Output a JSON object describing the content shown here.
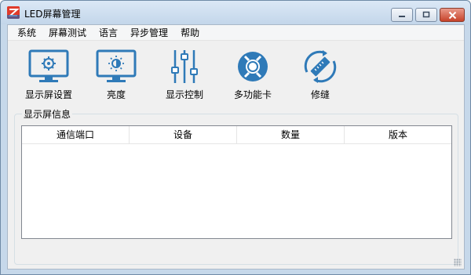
{
  "window": {
    "title": "LED屏幕管理"
  },
  "menu": [
    {
      "label": "系统",
      "name": "menu-system"
    },
    {
      "label": "屏幕测试",
      "name": "menu-screen-test"
    },
    {
      "label": "语言",
      "name": "menu-language"
    },
    {
      "label": "异步管理",
      "name": "menu-async-management"
    },
    {
      "label": "帮助",
      "name": "menu-help"
    }
  ],
  "toolbar": {
    "items": [
      {
        "label": "显示屏设置",
        "icon": "monitor-settings-icon"
      },
      {
        "label": "亮度",
        "icon": "monitor-brightness-icon"
      },
      {
        "label": "显示控制",
        "icon": "sliders-icon"
      },
      {
        "label": "多功能卡",
        "icon": "lifebuoy-icon"
      },
      {
        "label": "修缝",
        "icon": "ruler-rotate-icon"
      }
    ]
  },
  "display_info": {
    "title": "显示屏信息",
    "columns": [
      "通信端口",
      "设备",
      "数量",
      "版本"
    ],
    "rows": []
  },
  "colors": {
    "accent": "#2f7ab8",
    "titlebar": "#c6d8ea"
  }
}
